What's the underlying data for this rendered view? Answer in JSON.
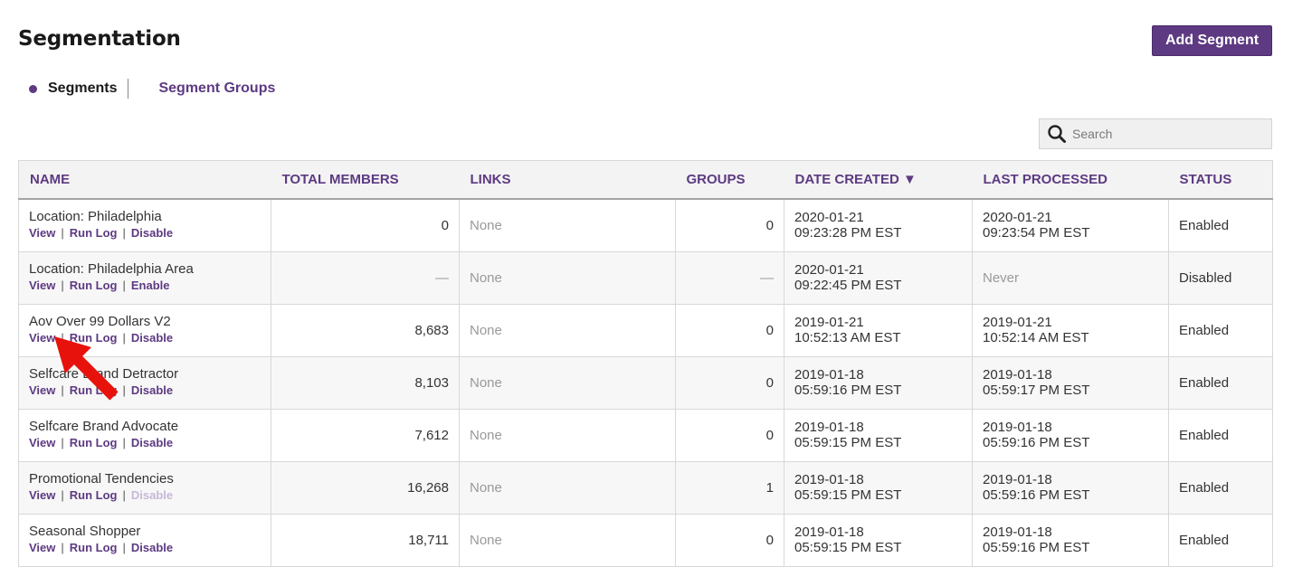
{
  "header": {
    "title": "Segmentation",
    "add_button_label": "Add Segment"
  },
  "tabs": {
    "active_label": "Segments",
    "inactive_label": "Segment Groups"
  },
  "search": {
    "placeholder": "Search",
    "value": ""
  },
  "table": {
    "columns": [
      "NAME",
      "TOTAL MEMBERS",
      "LINKS",
      "GROUPS",
      "DATE CREATED ▼",
      "LAST PROCESSED",
      "STATUS"
    ],
    "rows": [
      {
        "name": "Location: Philadelphia",
        "actions": [
          "View",
          "Run Log",
          "Disable"
        ],
        "third_action_enabled": true,
        "members": "0",
        "links": "None",
        "groups": "0",
        "created_date": "2020-01-21",
        "created_time": "09:23:28 PM EST",
        "processed_date": "2020-01-21",
        "processed_time": "09:23:54 PM EST",
        "status": "Enabled"
      },
      {
        "name": "Location: Philadelphia Area",
        "actions": [
          "View",
          "Run Log",
          "Enable"
        ],
        "third_action_enabled": true,
        "members": "—",
        "links": "None",
        "groups": "—",
        "created_date": "2020-01-21",
        "created_time": "09:22:45 PM EST",
        "processed_date": "Never",
        "processed_time": "",
        "status": "Disabled"
      },
      {
        "name": "Aov Over 99 Dollars V2",
        "actions": [
          "View",
          "Run Log",
          "Disable"
        ],
        "third_action_enabled": true,
        "members": "8,683",
        "links": "None",
        "groups": "0",
        "created_date": "2019-01-21",
        "created_time": "10:52:13 AM EST",
        "processed_date": "2019-01-21",
        "processed_time": "10:52:14 AM EST",
        "status": "Enabled"
      },
      {
        "name": "Selfcare Brand Detractor",
        "actions": [
          "View",
          "Run Log",
          "Disable"
        ],
        "third_action_enabled": true,
        "members": "8,103",
        "links": "None",
        "groups": "0",
        "created_date": "2019-01-18",
        "created_time": "05:59:16 PM EST",
        "processed_date": "2019-01-18",
        "processed_time": "05:59:17 PM EST",
        "status": "Enabled"
      },
      {
        "name": "Selfcare Brand Advocate",
        "actions": [
          "View",
          "Run Log",
          "Disable"
        ],
        "third_action_enabled": true,
        "members": "7,612",
        "links": "None",
        "groups": "0",
        "created_date": "2019-01-18",
        "created_time": "05:59:15 PM EST",
        "processed_date": "2019-01-18",
        "processed_time": "05:59:16 PM EST",
        "status": "Enabled"
      },
      {
        "name": "Promotional Tendencies",
        "actions": [
          "View",
          "Run Log",
          "Disable"
        ],
        "third_action_enabled": false,
        "members": "16,268",
        "links": "None",
        "groups": "1",
        "created_date": "2019-01-18",
        "created_time": "05:59:15 PM EST",
        "processed_date": "2019-01-18",
        "processed_time": "05:59:16 PM EST",
        "status": "Enabled"
      },
      {
        "name": "Seasonal Shopper",
        "actions": [
          "View",
          "Run Log",
          "Disable"
        ],
        "third_action_enabled": true,
        "members": "18,711",
        "links": "None",
        "groups": "0",
        "created_date": "2019-01-18",
        "created_time": "05:59:15 PM EST",
        "processed_date": "2019-01-18",
        "processed_time": "05:59:16 PM EST",
        "status": "Enabled"
      }
    ]
  },
  "colors": {
    "accent": "#5d3a82",
    "annotation_arrow": "#e8120c"
  },
  "icons": {
    "search": "magnifier-icon",
    "annotation": "red-arrow-icon"
  }
}
